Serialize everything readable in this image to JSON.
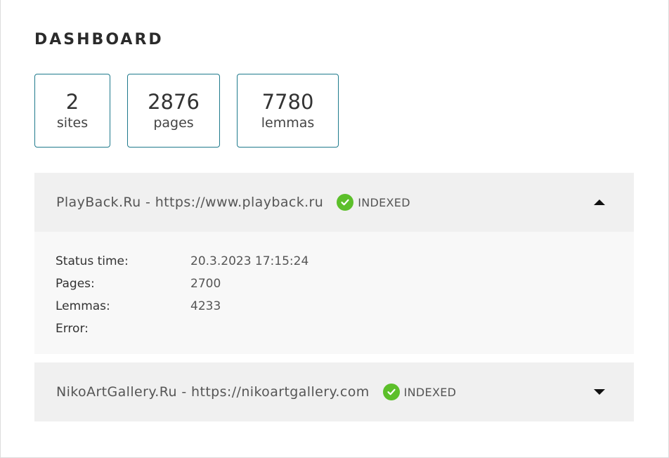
{
  "dashboard": {
    "title": "DASHBOARD"
  },
  "stats": [
    {
      "value": "2",
      "label": "sites"
    },
    {
      "value": "2876",
      "label": "pages"
    },
    {
      "value": "7780",
      "label": "lemmas"
    }
  ],
  "sites": [
    {
      "name": "PlayBack.Ru - https://www.playback.ru",
      "status": "INDEXED",
      "expanded": true,
      "details": {
        "status_time_label": "Status time:",
        "status_time": "20.3.2023 17:15:24",
        "pages_label": "Pages:",
        "pages": "2700",
        "lemmas_label": "Lemmas:",
        "lemmas": "4233",
        "error_label": "Error:",
        "error": ""
      }
    },
    {
      "name": "NikoArtGallery.Ru - https://nikoartgallery.com",
      "status": "INDEXED",
      "expanded": false
    }
  ],
  "colors": {
    "accent_border": "#1f7a8c",
    "status_green": "#5cbf2a",
    "header_bg": "#f0f0f0",
    "details_bg": "#f8f8f8"
  },
  "icons": {
    "status": "check-circle-icon",
    "expanded": "chevron-up-icon",
    "collapsed": "chevron-down-icon"
  }
}
